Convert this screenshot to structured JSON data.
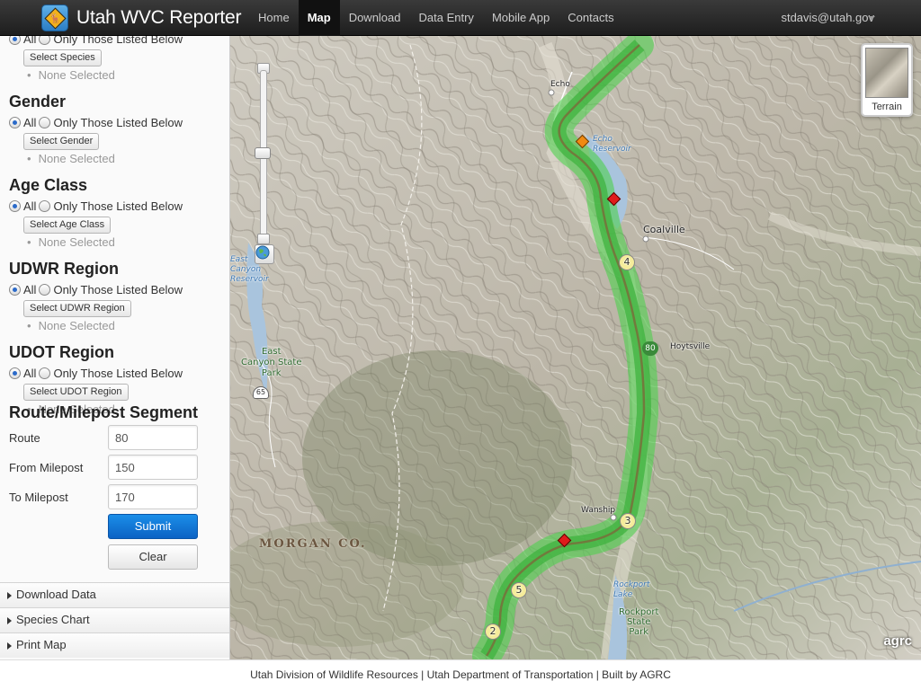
{
  "brand": {
    "title": "Utah WVC Reporter",
    "logo_icon": "road-sign-deer-icon"
  },
  "nav": {
    "items": [
      {
        "label": "Home",
        "active": false
      },
      {
        "label": "Map",
        "active": true
      },
      {
        "label": "Download",
        "active": false
      },
      {
        "label": "Data Entry",
        "active": false
      },
      {
        "label": "Mobile App",
        "active": false
      },
      {
        "label": "Contacts",
        "active": false
      }
    ],
    "user": "stdavis@utah.gov"
  },
  "filters": {
    "species": {
      "radio_all": "All",
      "radio_listed": "Only Those Listed Below",
      "select_label": "Select Species",
      "selection": "None Selected"
    },
    "gender": {
      "title": "Gender",
      "radio_all": "All",
      "radio_listed": "Only Those Listed Below",
      "select_label": "Select Gender",
      "selection": "None Selected"
    },
    "age_class": {
      "title": "Age Class",
      "radio_all": "All",
      "radio_listed": "Only Those Listed Below",
      "select_label": "Select Age Class",
      "selection": "None Selected"
    },
    "udwr_region": {
      "title": "UDWR Region",
      "radio_all": "All",
      "radio_listed": "Only Those Listed Below",
      "select_label": "Select UDWR Region",
      "selection": "None Selected"
    },
    "udot_region": {
      "title": "UDOT Region",
      "radio_all": "All",
      "radio_listed": "Only Those Listed Below",
      "select_label": "Select UDOT Region",
      "selection": "None Selected"
    }
  },
  "segment": {
    "title": "Route/Milepost Segment",
    "route_label": "Route",
    "route_value": "80",
    "from_label": "From Milepost",
    "from_value": "150",
    "to_label": "To Milepost",
    "to_value": "170",
    "submit_label": "Submit",
    "clear_label": "Clear"
  },
  "accordion": [
    "Download Data",
    "Species Chart",
    "Print Map"
  ],
  "map": {
    "labels": {
      "echo": "Echo",
      "echo_reservoir": "Echo\nReservoir",
      "coalville": "Coalville",
      "hoytsville": "Hoytsville",
      "east_canyon_reservoir": "East\nCanyon\nReservoir",
      "east_canyon_state_park": "East\nCanyon State\nPark",
      "wanship": "Wanship",
      "rockport_lake": "Rockport\nLake",
      "rockport_state_park": "Rockport\nState\nPark",
      "morgan_co": "MORGAN CO.",
      "interstate": "80",
      "state_route": "65"
    },
    "mileposts": [
      "4",
      "3",
      "5",
      "2"
    ],
    "incident_colors": {
      "red": "#e01b1b",
      "orange": "#f08a12"
    },
    "segment_color": "#4fd14f",
    "basemap_label": "Terrain",
    "attribution": "agrc"
  },
  "footer": "Utah Division of Wildlife Resources | Utah Department of Transportation | Built by AGRC"
}
